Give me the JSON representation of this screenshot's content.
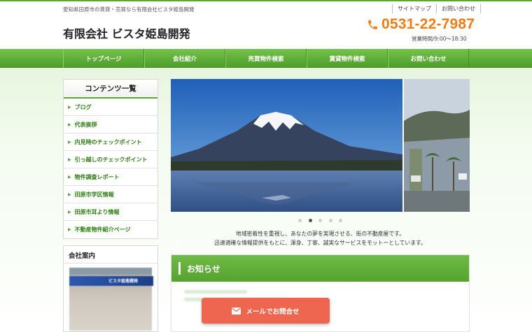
{
  "header": {
    "tagline": "愛知県田原市の賃貸・売買なら有限会社ビスタ姫島開発",
    "company_name": "有限会社 ビスタ姫島開発",
    "links": [
      "サイトマップ",
      "お問い合わせ"
    ],
    "phone": "0531-22-7987",
    "hours": "営業時間/9:00～18:30"
  },
  "nav": {
    "items": [
      "トップページ",
      "会社紹介",
      "売買物件検索",
      "賃貸物件検索",
      "お問い合わせ"
    ]
  },
  "sidebar": {
    "title": "コンテンツ一覧",
    "items": [
      "ブログ",
      "代表挨拶",
      "内見時のチェックポイント",
      "引っ越しのチェックポイント",
      "物件調査レポート",
      "田原市学区情報",
      "田原市耳より情報",
      "不動産物件紹介ページ"
    ],
    "company_title": "会社案内",
    "company_sign": "ビスタ姫島開発"
  },
  "slider": {
    "slide_count": 5,
    "active_index": 1
  },
  "intro": {
    "line1": "地域密着性を重視し、あなたの夢を実現させる、街の不動産屋です。",
    "line2": "迅速適確な情報提供をもとに、渾身、丁寧、誠実なサービスをモットーとしています。"
  },
  "news": {
    "title": "お知らせ"
  },
  "mail_button": {
    "label": "メールでお問合せ"
  },
  "colors": {
    "accent_green": "#5aa832",
    "phone_orange": "#ef7d15",
    "button_red": "#ee6650"
  },
  "icons": {
    "phone": "phone-icon",
    "mail": "mail-icon",
    "bullet": "arrow-right-icon"
  }
}
